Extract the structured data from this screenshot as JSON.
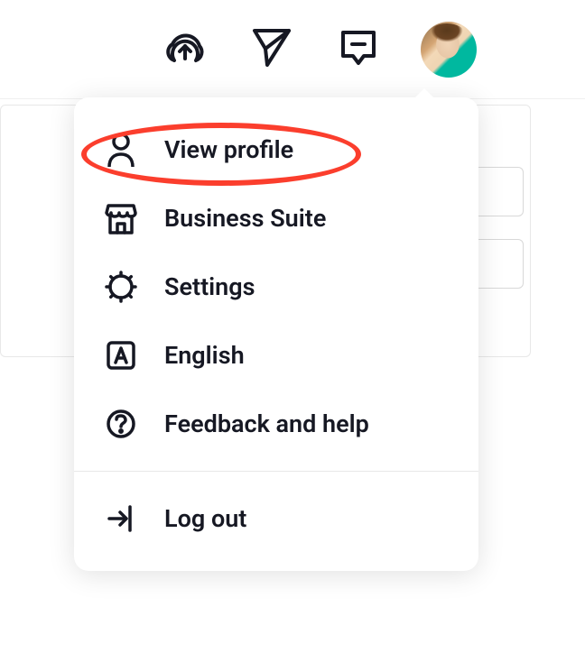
{
  "topbar": {
    "uploadIcon": "upload",
    "sendIcon": "send",
    "inboxIcon": "inbox"
  },
  "menu": {
    "viewProfile": "View profile",
    "businessSuite": "Business Suite",
    "settings": "Settings",
    "language": "English",
    "feedback": "Feedback and help",
    "logout": "Log out"
  }
}
